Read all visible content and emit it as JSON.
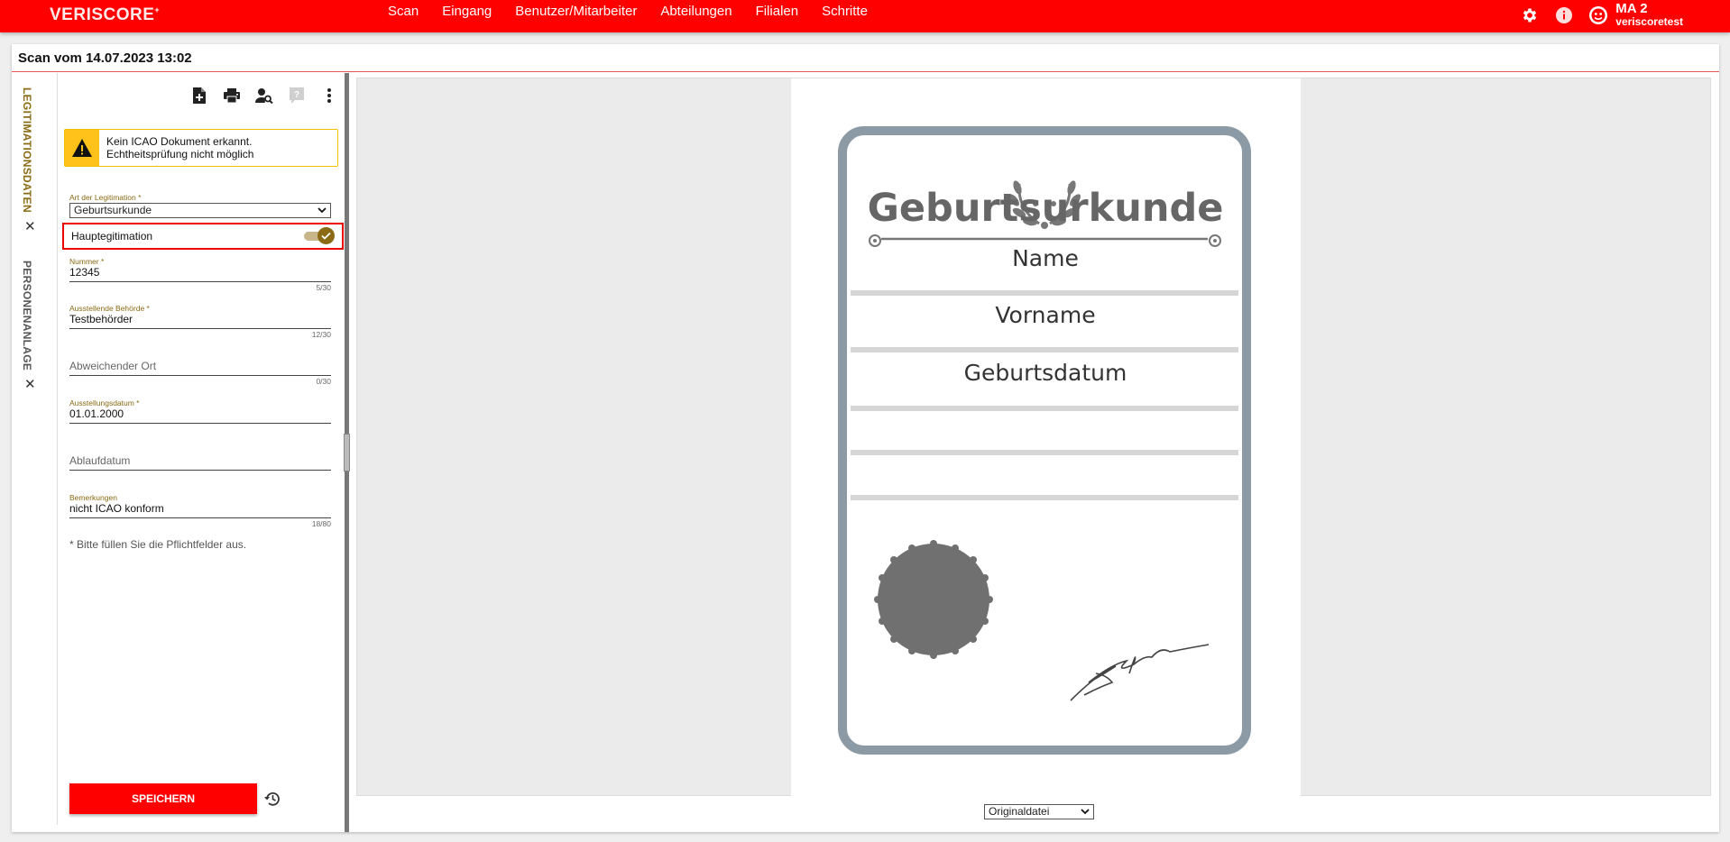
{
  "app": {
    "logo_main": "VERISCORE",
    "logo_sup": "+"
  },
  "nav": [
    "Scan",
    "Eingang",
    "Benutzer/Mitarbeiter",
    "Abteilungen",
    "Filialen",
    "Schritte"
  ],
  "user": {
    "name": "MA 2",
    "account": "veriscoretest"
  },
  "page": {
    "title": "Scan vom 14.07.2023 13:02"
  },
  "tabs": [
    {
      "label": "LEGITIMATIONSDATEN",
      "close": "✕"
    },
    {
      "label": "PERSONENANLAGE",
      "close": "✕"
    }
  ],
  "alert": {
    "line1": "Kein ICAO Dokument erkannt.",
    "line2": "Echtheitsprüfung nicht möglich"
  },
  "form": {
    "art": {
      "label": "Art der Legitimation *",
      "value": "Geburtsurkunde"
    },
    "haupt": {
      "label": "Hauptegitimation",
      "checked": true
    },
    "nummer": {
      "label": "Nummer *",
      "value": "12345",
      "count": "5/30"
    },
    "behoerde": {
      "label": "Ausstellende Behörde *",
      "value": "Testbehörder",
      "count": "12/30"
    },
    "ort": {
      "placeholder": "Abweichender Ort",
      "count": "0/30"
    },
    "ausstellung": {
      "label": "Ausstellungsdatum *",
      "value": "01.01.2000"
    },
    "ablauf": {
      "placeholder": "Ablaufdatum"
    },
    "bemerkungen": {
      "label": "Bemerkungen",
      "value": "nicht ICAO konform",
      "count": "18/80"
    },
    "required_note": "* Bitte füllen Sie die Pflichtfelder aus.",
    "save_label": "SPEICHERN"
  },
  "document": {
    "title": "Geburtsurkunde",
    "fields": [
      "Name",
      "Vorname",
      "Geburtsdatum"
    ],
    "signature": "Signature"
  },
  "viewer": {
    "file_select": "Originaldatei"
  },
  "colors": {
    "brand": "#ff0000",
    "accent": "#8a6a13",
    "warning": "#ffc21a"
  }
}
